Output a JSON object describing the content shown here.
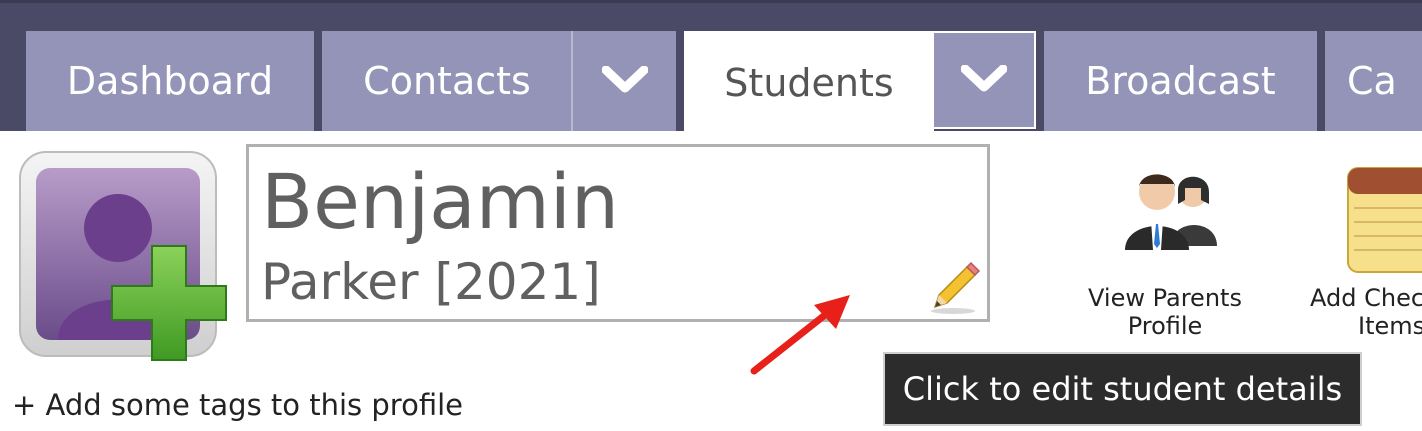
{
  "nav": {
    "tabs": [
      {
        "label": "Dashboard"
      },
      {
        "label": "Contacts"
      },
      {
        "label": "Students"
      },
      {
        "label": "Broadcast"
      },
      {
        "label": "Ca"
      }
    ]
  },
  "student": {
    "first_name": "Benjamin",
    "last_name_year": "Parker [2021]"
  },
  "actions": {
    "view_parents_line1": "View Parents",
    "view_parents_line2": "Profile",
    "add_checklist_line1": "Add Chec",
    "add_checklist_line2": "Items"
  },
  "tags": {
    "add_label": "+ Add some tags to this profile"
  },
  "tooltip": {
    "text": "Click to edit student details"
  },
  "colors": {
    "topbar": "#4a4a66",
    "tab": "#9494b8",
    "tooltip_bg": "#2c2c2c",
    "arrow": "#e8201a"
  },
  "icons": {
    "avatar": "add-user-icon",
    "edit": "pencil-icon",
    "parents": "parents-icon",
    "checklist": "notepad-icon",
    "dropdown": "chevron-down-icon"
  }
}
